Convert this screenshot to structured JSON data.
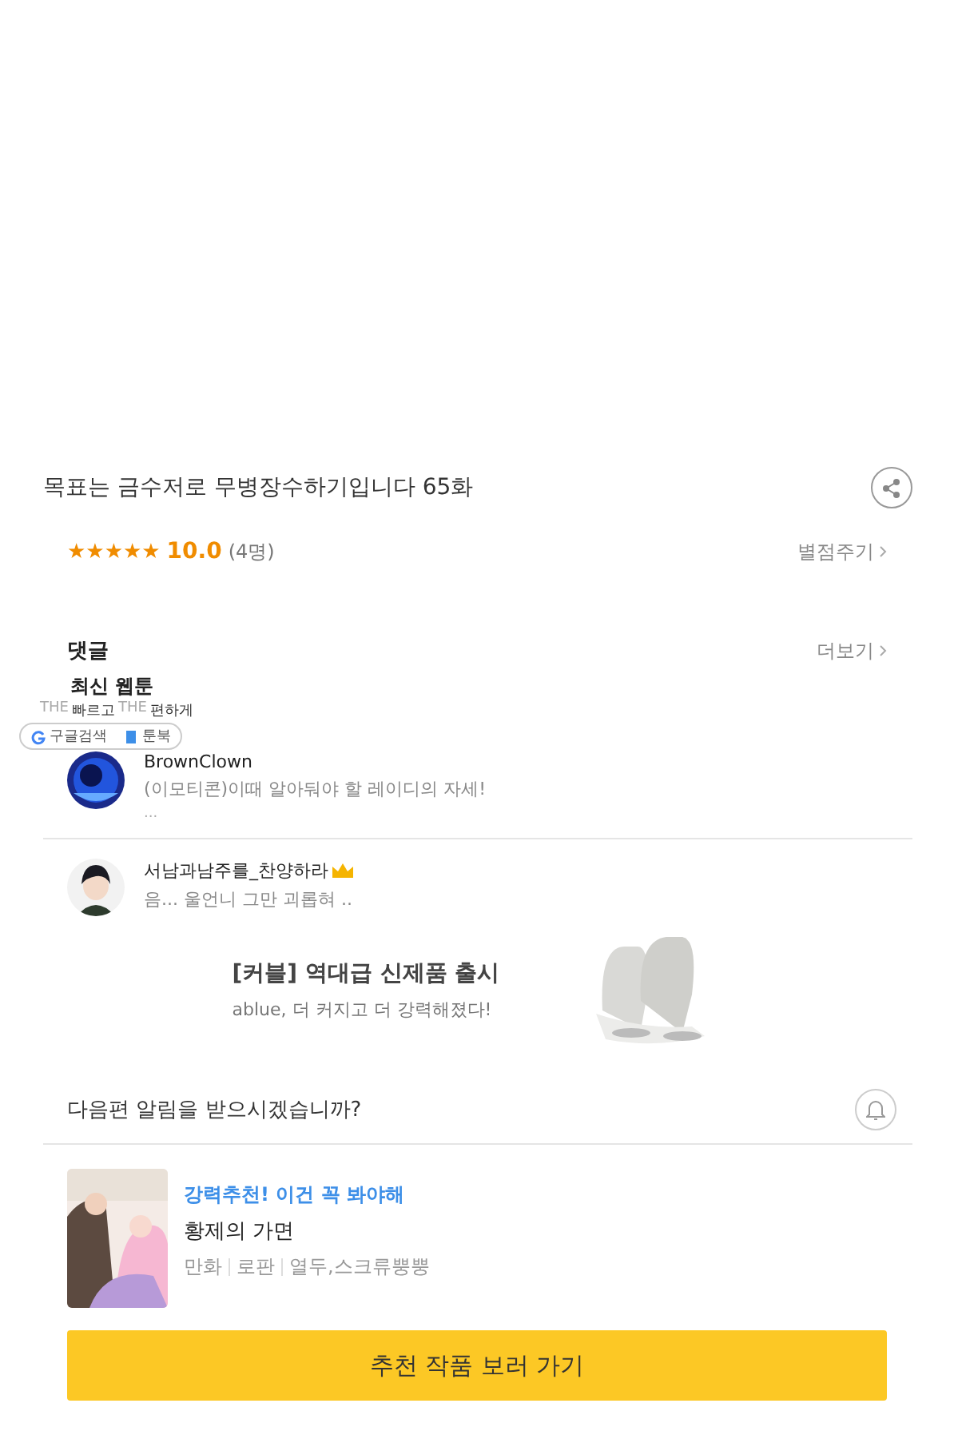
{
  "episode": {
    "title": "목표는 금수저로 무병장수하기입니다 65화"
  },
  "rating": {
    "stars": 5,
    "star_glyph": "★",
    "score": "10.0",
    "count": "(4명)",
    "action": "별점주기"
  },
  "comments": {
    "heading": "댓글",
    "more": "더보기",
    "items": [
      {
        "author": "BrownClown",
        "crown": false,
        "text": "(이모티콘)이때 알아둬야 할 레이디의 자세!",
        "extra": "..."
      },
      {
        "author": "서남과남주를_찬양하라",
        "crown": true,
        "text": "음... 울언니 그만 괴롭혀 .."
      }
    ]
  },
  "overlay": {
    "title": "최신 웹툰",
    "tagline": [
      {
        "text": "THE",
        "muted": true
      },
      {
        "text": "빠르고",
        "muted": false
      },
      {
        "text": "THE",
        "muted": true
      },
      {
        "text": "편하게",
        "muted": false
      }
    ],
    "links": [
      {
        "kind": "google",
        "label": "구글검색"
      },
      {
        "kind": "book",
        "label": "툰북"
      }
    ]
  },
  "ad": {
    "title": "[커블] 역대급 신제품 출시",
    "subtitle": "ablue, 더 커지고 더 강력해졌다!"
  },
  "notify": {
    "question": "다음편 알림을 받으시겠습니까?"
  },
  "recommend": {
    "tag": "강력추천! 이건 꼭 봐야해",
    "title": "황제의 가면",
    "meta": [
      "만화",
      "로판",
      "열두,스크류뿡뿡"
    ],
    "button": "추천 작품 보러 가기"
  }
}
